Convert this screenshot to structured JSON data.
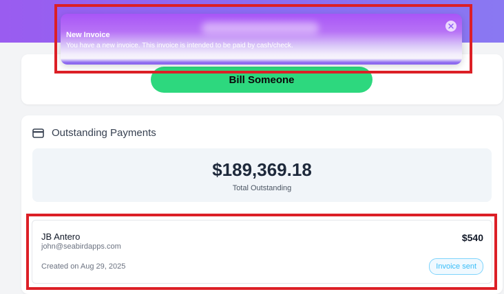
{
  "colors": {
    "accent_purple": "#9a5cf0",
    "bill_button_green": "#2dd87e",
    "badge_blue": "#38bdf8",
    "highlight_red": "#dc1f26"
  },
  "bill": {
    "button_label": "Bill Someone"
  },
  "outstanding": {
    "icon": "credit-card-icon",
    "title": "Outstanding Payments",
    "total_amount": "$189,369.18",
    "total_label": "Total Outstanding"
  },
  "invoices": [
    {
      "name": "JB Antero",
      "email": "john@seabirdapps.com",
      "created": "Created on Aug 29, 2025",
      "amount": "$540",
      "status": "Invoice sent"
    }
  ],
  "toast": {
    "title": "New Invoice",
    "message": "You have a new invoice. This invoice is intended to be paid by cash/check.",
    "close_icon": "close-icon"
  }
}
